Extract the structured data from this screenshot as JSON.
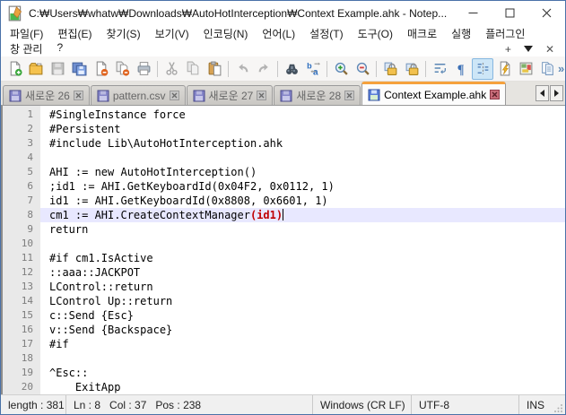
{
  "window": {
    "title": "C:₩Users₩whatw₩Downloads₩AutoHotInterception₩Context Example.ahk - Notep...",
    "controls": {
      "minimize": "minimize",
      "maximize": "maximize",
      "close": "close"
    }
  },
  "menubar": {
    "row1": [
      "파일(F)",
      "편집(E)",
      "찾기(S)",
      "보기(V)",
      "인코딩(N)",
      "언어(L)",
      "설정(T)",
      "도구(O)",
      "매크로",
      "실행",
      "플러그인"
    ],
    "row2": [
      "창 관리",
      "?"
    ],
    "extra_buttons": [
      "plus",
      "dropdown-triangle",
      "close-x"
    ]
  },
  "toolbar": {
    "items": [
      {
        "name": "new-file"
      },
      {
        "name": "open-file"
      },
      {
        "name": "save",
        "disabled": true
      },
      {
        "name": "save-all"
      },
      {
        "name": "close-file"
      },
      {
        "name": "close-all"
      },
      {
        "name": "print"
      },
      {
        "sep": true
      },
      {
        "name": "cut",
        "disabled": true
      },
      {
        "name": "copy",
        "disabled": true
      },
      {
        "name": "paste"
      },
      {
        "sep": true
      },
      {
        "name": "undo",
        "disabled": true
      },
      {
        "name": "redo",
        "disabled": true
      },
      {
        "sep": true
      },
      {
        "name": "find"
      },
      {
        "name": "replace"
      },
      {
        "sep": true
      },
      {
        "name": "zoom-in"
      },
      {
        "name": "zoom-out"
      },
      {
        "sep": true
      },
      {
        "name": "sync-vertical-scroll"
      },
      {
        "name": "sync-horizontal-scroll"
      },
      {
        "sep": true
      },
      {
        "name": "word-wrap"
      },
      {
        "name": "show-all-characters"
      },
      {
        "name": "indent-guide",
        "active": true
      },
      {
        "name": "function-list"
      },
      {
        "name": "document-map"
      },
      {
        "name": "document-list"
      }
    ],
    "overflow_chevron": "»"
  },
  "tabbar": {
    "tabs": [
      {
        "label": "새로운 26",
        "active": false
      },
      {
        "label": "pattern.csv",
        "active": false
      },
      {
        "label": "새로운 27",
        "active": false
      },
      {
        "label": "새로운 28",
        "active": false
      },
      {
        "label": "Context Example.ahk",
        "active": true
      }
    ]
  },
  "editor": {
    "lines": [
      {
        "n": 1,
        "segments": [
          {
            "text": "#SingleInstance force"
          }
        ]
      },
      {
        "n": 2,
        "segments": [
          {
            "text": "#Persistent"
          }
        ]
      },
      {
        "n": 3,
        "segments": [
          {
            "text": "#include Lib\\AutoHotInterception.ahk"
          }
        ]
      },
      {
        "n": 4,
        "segments": []
      },
      {
        "n": 5,
        "segments": [
          {
            "text": "AHI := new AutoHotInterception()"
          }
        ]
      },
      {
        "n": 6,
        "segments": [
          {
            "text": ";id1 := AHI.GetKeyboardId(0x04F2, 0x0112, 1)"
          }
        ]
      },
      {
        "n": 7,
        "segments": [
          {
            "text": "id1 := AHI.GetKeyboardId(0x8808, 0x6601, 1)"
          }
        ]
      },
      {
        "n": 8,
        "segments": [
          {
            "text": "cm1 := AHI.CreateContextManager"
          },
          {
            "text": "(id1)",
            "style": "brace-match"
          }
        ],
        "current": true,
        "caret_after": true
      },
      {
        "n": 9,
        "segments": [
          {
            "text": "return"
          }
        ]
      },
      {
        "n": 10,
        "segments": []
      },
      {
        "n": 11,
        "segments": [
          {
            "text": "#if cm1.IsActive"
          }
        ]
      },
      {
        "n": 12,
        "segments": [
          {
            "text": "::aaa::JACKPOT"
          }
        ]
      },
      {
        "n": 13,
        "segments": [
          {
            "text": "LControl::return"
          }
        ]
      },
      {
        "n": 14,
        "segments": [
          {
            "text": "LControl Up::return"
          }
        ]
      },
      {
        "n": 15,
        "segments": [
          {
            "text": "c::Send {Esc}"
          }
        ]
      },
      {
        "n": 16,
        "segments": [
          {
            "text": "v::Send {Backspace}"
          }
        ]
      },
      {
        "n": 17,
        "segments": [
          {
            "text": "#if"
          }
        ]
      },
      {
        "n": 18,
        "segments": []
      },
      {
        "n": 19,
        "segments": [
          {
            "text": "^Esc::"
          }
        ]
      },
      {
        "n": 20,
        "segments": [
          {
            "text": "    ExitApp"
          }
        ]
      }
    ]
  },
  "statusbar": {
    "doc_length": "length : 381   l",
    "position": "Ln : 8   Col : 37   Pos : 238",
    "eol_format": "Windows (CR LF)",
    "encoding": "UTF-8",
    "typing_mode": "INS"
  },
  "colors": {
    "active_tab_indicator": "#f5a13d",
    "current_line_background": "#e8e8ff",
    "brace_match": "#c00000",
    "window_border": "#4a72a8"
  }
}
